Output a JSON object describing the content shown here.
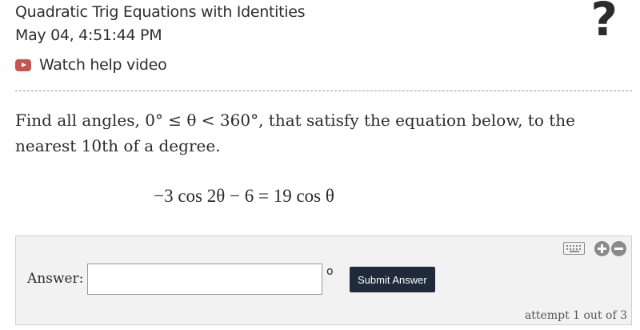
{
  "header": {
    "title": "Quadratic Trig Equations with Identities",
    "timestamp": "May 04, 4:51:44 PM",
    "help_link": "Watch help video",
    "help_icon": "?"
  },
  "question": {
    "text": "Find all angles, 0° ≤ θ < 360°, that satisfy the equation below, to the nearest 10th of a degree.",
    "equation": "−3 cos 2θ − 6 = 19 cos θ"
  },
  "answer": {
    "label": "Answer:",
    "value": "",
    "placeholder": "",
    "unit": "o",
    "submit_label": "Submit Answer",
    "attempt_text": "attempt 1 out of 3"
  },
  "colors": {
    "video_icon": "#c9524f",
    "submit_bg": "#1f2b3a",
    "answer_panel_bg": "#f2f2f2"
  },
  "icons": [
    "play-video-icon",
    "help-question-icon",
    "keyboard-icon",
    "zoom-in-icon",
    "zoom-out-icon"
  ]
}
